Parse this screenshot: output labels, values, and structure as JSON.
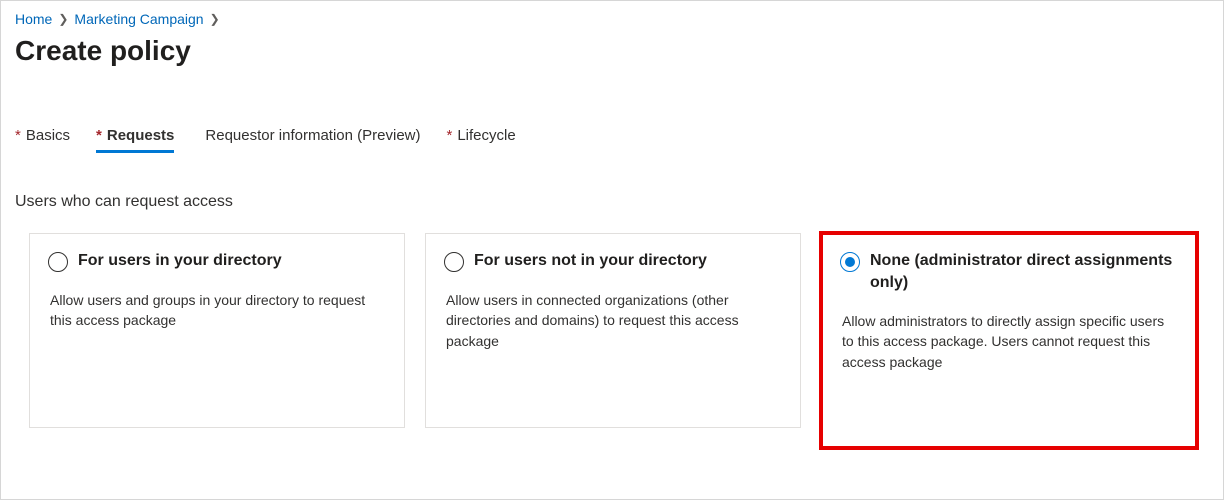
{
  "breadcrumb": {
    "items": [
      {
        "label": "Home"
      },
      {
        "label": "Marketing Campaign"
      }
    ]
  },
  "page": {
    "title": "Create policy"
  },
  "tabs": {
    "basics": {
      "label": "Basics",
      "required": "*"
    },
    "requests": {
      "label": "Requests",
      "required": "*"
    },
    "requestor_info": {
      "label": "Requestor information (Preview)",
      "required": ""
    },
    "lifecycle": {
      "label": "Lifecycle",
      "required": "*"
    }
  },
  "section": {
    "heading": "Users who can request access"
  },
  "options": {
    "in_directory": {
      "title": "For users in your directory",
      "desc": "Allow users and groups in your directory to request this access package"
    },
    "not_in_directory": {
      "title": "For users not in your directory",
      "desc": "Allow users in connected organizations (other directories and domains) to request this access package"
    },
    "none": {
      "title": "None (administrator direct assignments only)",
      "desc": "Allow administrators to directly assign specific users to this access package. Users cannot request this access package"
    }
  }
}
